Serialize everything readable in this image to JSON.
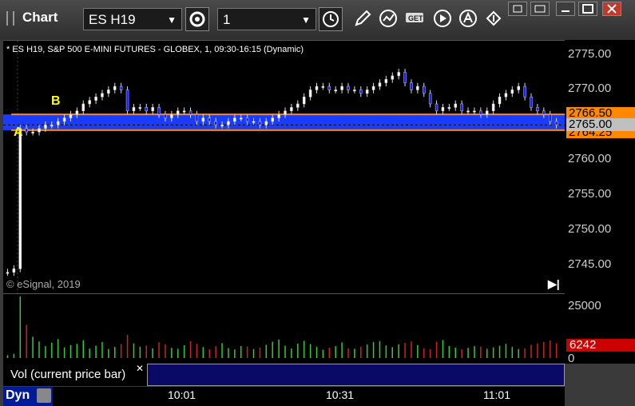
{
  "window": {
    "title": "Chart"
  },
  "toolbar": {
    "symbol": "ES H19",
    "interval": "1",
    "buttons": [
      "settings",
      "time-cycle",
      "draw",
      "studies",
      "get",
      "play",
      "alerts",
      "arrows"
    ]
  },
  "chart": {
    "header": "* ES H19, S&P 500 E-MINI FUTURES - GLOBEX, 1, 09:30-16:15 (Dynamic)",
    "copyright": "© eSignal, 2019",
    "price_ticks": [
      "2775.00",
      "2770.00",
      "2765.00",
      "2760.00",
      "2755.00",
      "2750.00",
      "2745.00"
    ],
    "price_min": 2741.0,
    "price_max": 2777.0,
    "levels": {
      "upper": "2766.50",
      "current": "2765.00",
      "lower": "2764.25"
    },
    "level_values": {
      "upper": 2766.5,
      "current": 2765.0,
      "lower": 2764.25
    },
    "annotations": [
      {
        "label": "A"
      },
      {
        "label": "B"
      }
    ],
    "colors": {
      "upper_line": "#ff8800",
      "band": "#1a3cff",
      "current_bg": "#c0c0c0",
      "annotation": "#ffff00"
    }
  },
  "volume": {
    "legend": "Vol (current price bar)",
    "ticks": [
      "25000",
      "0"
    ],
    "current": "6242",
    "max": 27000
  },
  "time_axis": {
    "labels": [
      "10:01",
      "10:31",
      "11:01"
    ]
  },
  "footer": {
    "mode": "Dyn"
  },
  "chart_data": {
    "type": "candlestick",
    "ylim": [
      2741,
      2777
    ],
    "series": [
      {
        "name": "price",
        "values": [
          2744,
          2744.5,
          2764.5,
          2764,
          2764,
          2764.5,
          2765,
          2765,
          2765.5,
          2766,
          2766.5,
          2767,
          2768,
          2768.5,
          2769,
          2769.5,
          2770,
          2770.5,
          2770,
          2767,
          2767.5,
          2767.5,
          2767,
          2767.5,
          2766.5,
          2766,
          2766.5,
          2767,
          2767,
          2766.5,
          2765.5,
          2766,
          2765.5,
          2765,
          2765,
          2765.5,
          2766,
          2766,
          2765.5,
          2765.5,
          2765,
          2765.5,
          2766,
          2766.5,
          2767,
          2767.5,
          2768,
          2769,
          2770,
          2770.5,
          2770.5,
          2770,
          2770,
          2770.5,
          2770,
          2770,
          2769.5,
          2770,
          2770.5,
          2771,
          2771.5,
          2772,
          2772.5,
          2771,
          2770,
          2770.5,
          2769.5,
          2768,
          2767,
          2767.5,
          2767.5,
          2768,
          2767,
          2767,
          2767,
          2766.5,
          2767,
          2768,
          2769,
          2769.5,
          2770,
          2770.5,
          2769,
          2767.5,
          2767,
          2766.5,
          2765.5,
          2765
        ]
      },
      {
        "name": "volume",
        "values": [
          1200,
          1800,
          26000,
          14000,
          9000,
          7000,
          5000,
          6500,
          8000,
          4500,
          5500,
          6000,
          7500,
          4000,
          5200,
          6800,
          3800,
          4700,
          5900,
          9800,
          6200,
          4800,
          5300,
          4100,
          6700,
          5800,
          4300,
          3900,
          5400,
          7100,
          6000,
          4600,
          3700,
          5000,
          6300,
          4200,
          3600,
          5100,
          4900,
          3800,
          4400,
          5600,
          6900,
          7800,
          5200,
          4000,
          6100,
          7300,
          5900,
          4700,
          3500,
          4300,
          5000,
          6600,
          4100,
          3900,
          4800,
          5700,
          6800,
          7200,
          5300,
          4600,
          5800,
          6400,
          7000,
          5500,
          4200,
          3800,
          6900,
          7600,
          5100,
          4400,
          3700,
          4300,
          5000,
          4800,
          3900,
          4500,
          5200,
          6000,
          4700,
          3800,
          4100,
          5600,
          6200,
          6800,
          7400,
          6242
        ]
      }
    ]
  }
}
